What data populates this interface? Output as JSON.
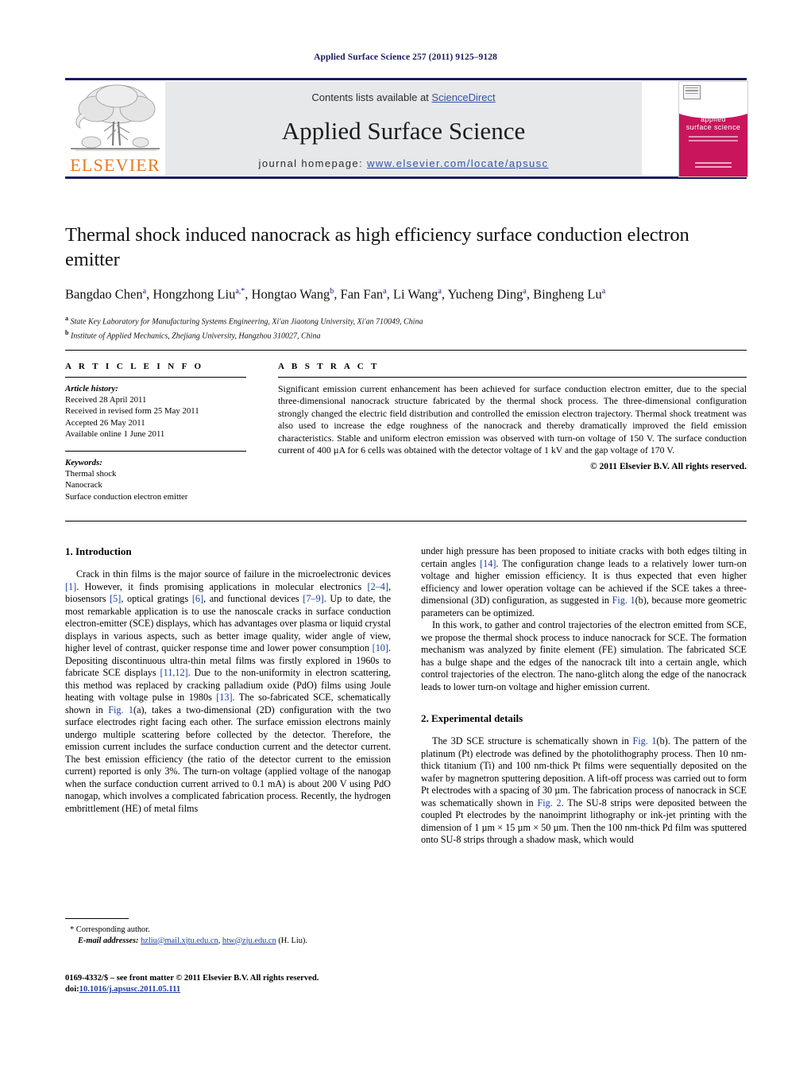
{
  "running_head": "Applied Surface Science 257 (2011) 9125–9128",
  "masthead": {
    "contents_prefix": "Contents lists available at ",
    "sciencedirect": "ScienceDirect",
    "journal_title": "Applied Surface Science",
    "homepage_prefix": "journal homepage: ",
    "homepage_url": "www.elsevier.com/locate/apsusc",
    "publisher_wordmark": "ELSEVIER",
    "publisher_logo_icon": "elsevier-tree-icon",
    "cover_title_line1": "applied",
    "cover_title_line2": "surface science",
    "cover_color": "#c9155b",
    "wordmark_color": "#E87722",
    "link_color": "#2f53a7"
  },
  "article": {
    "title": "Thermal shock induced nanocrack as high efficiency surface conduction electron emitter",
    "authors_html": "Bangdao Chen<sup>a</sup>, Hongzhong Liu<sup>a,*</sup>, Hongtao Wang<sup>b</sup>, Fan Fan<sup>a</sup>, Li Wang<sup>a</sup>, Yucheng Ding<sup>a</sup>, Bingheng Lu<sup>a</sup>",
    "affiliation_a": "State Key Laboratory for Manufacturing Systems Engineering, Xi'an Jiaotong University, Xi'an 710049, China",
    "affiliation_b": "Institute of Applied Mechanics, Zhejiang University, Hangzhou 310027, China",
    "affiliation_a_mark": "a",
    "affiliation_b_mark": "b"
  },
  "info": {
    "heading": "A R T I C L E    I N F O",
    "history_label": "Article history:",
    "history": [
      "Received 28 April 2011",
      "Received in revised form 25 May 2011",
      "Accepted 26 May 2011",
      "Available online 1 June 2011"
    ],
    "keywords_label": "Keywords:",
    "keywords": [
      "Thermal shock",
      "Nanocrack",
      "Surface conduction electron emitter"
    ]
  },
  "abstract": {
    "heading": "A B S T R A C T",
    "text": "Significant emission current enhancement has been achieved for surface conduction electron emitter, due to the special three-dimensional nanocrack structure fabricated by the thermal shock process. The three-dimensional configuration strongly changed the electric field distribution and controlled the emission electron trajectory. Thermal shock treatment was also used to increase the edge roughness of the nanocrack and thereby dramatically improved the field emission characteristics. Stable and uniform electron emission was observed with turn-on voltage of 150 V. The surface conduction current of 400 µA for 6 cells was obtained with the detector voltage of 1 kV and the gap voltage of 170 V.",
    "copyright": "© 2011 Elsevier B.V. All rights reserved."
  },
  "sections": {
    "intro_heading": "1.  Introduction",
    "intro_p1_a": "Crack in thin films is the major source of failure in the microelectronic devices ",
    "intro_p1_r1": "[1]",
    "intro_p1_b": ". However, it finds promising applications in molecular electronics ",
    "intro_p1_r2": "[2–4]",
    "intro_p1_c": ", biosensors ",
    "intro_p1_r3": "[5]",
    "intro_p1_d": ", optical gratings ",
    "intro_p1_r4": "[6]",
    "intro_p1_e": ", and functional devices ",
    "intro_p1_r5": "[7–9]",
    "intro_p1_f": ". Up to date, the most remarkable application is to use the nanoscale cracks in surface conduction electron-emitter (SCE) displays, which has advantages over plasma or liquid crystal displays in various aspects, such as better image quality, wider angle of view, higher level of contrast, quicker response time and lower power consumption ",
    "intro_p1_r6": "[10]",
    "intro_p1_g": ". Depositing discontinuous ultra-thin metal films was firstly explored in 1960s to fabricate SCE displays ",
    "intro_p1_r7": "[11,12]",
    "intro_p1_h": ". Due to the non-uniformity in electron scattering, this method was replaced by cracking palladium oxide (PdO) films using Joule heating with voltage pulse in 1980s ",
    "intro_p1_r8": "[13]",
    "intro_p1_i": ". The so-fabricated SCE, schematically shown in ",
    "intro_p1_f1": "Fig. 1",
    "intro_p1_j": "(a), takes a two-dimensional (2D) configuration with the two surface electrodes right facing each other. The surface emission electrons mainly undergo multiple scattering before collected by the detector. Therefore, the emission current includes the surface conduction current and the detector current. The best emission efficiency (the ratio of the detector current to the emission current) reported is only 3%. The turn-on voltage (applied voltage of the nanogap when the surface conduction current arrived to 0.1 mA) is about 200 V using PdO nanogap, which involves a complicated fabrication process. Recently, the hydrogen embrittlement (HE) of metal films",
    "intro_p2_a": "under high pressure has been proposed to initiate cracks with both edges tilting in certain angles ",
    "intro_p2_r1": "[14]",
    "intro_p2_b": ". The configuration change leads to a relatively lower turn-on voltage and higher emission efficiency. It is thus expected that even higher efficiency and lower operation voltage can be achieved if the SCE takes a three-dimensional (3D) configuration, as suggested in ",
    "intro_p2_f1": "Fig. 1",
    "intro_p2_c": "(b), because more geometric parameters can be optimized.",
    "intro_p3": "In this work, to gather and control trajectories of the electron emitted from SCE, we propose the thermal shock process to induce nanocrack for SCE. The formation mechanism was analyzed by finite element (FE) simulation. The fabricated SCE has a bulge shape and the edges of the nanocrack tilt into a certain angle, which control trajectories of the electron. The nano-glitch along the edge of the nanocrack leads to lower turn-on voltage and higher emission current.",
    "exp_heading": "2.  Experimental details",
    "exp_p1_a": "The 3D SCE structure is schematically shown in ",
    "exp_p1_f1": "Fig. 1",
    "exp_p1_b": "(b). The pattern of the platinum (Pt) electrode was defined by the photolithography process. Then 10 nm-thick titanium (Ti) and 100 nm-thick Pt films were sequentially deposited on the wafer by magnetron sputtering deposition. A lift-off process was carried out to form Pt electrodes with a spacing of 30 µm. The fabrication process of nanocrack in SCE was schematically shown in ",
    "exp_p1_f2": "Fig. 2",
    "exp_p1_c": ". The SU-8 strips were deposited between the coupled Pt electrodes by the nanoimprint lithography or ink-jet printing with the dimension of 1 µm × 15 µm × 50 µm. Then the 100 nm-thick Pd film was sputtered onto SU-8 strips through a shadow mask, which would"
  },
  "footnotes": {
    "corresponding": "* Corresponding author.",
    "email_label": "E-mail addresses:",
    "email_1": "hzliu@mail.xjtu.edu.cn",
    "email_sep": ", ",
    "email_2": "htw@zju.edu.cn",
    "email_suffix": " (H. Liu).",
    "imprint": "0169-4332/$ – see front matter © 2011 Elsevier B.V. All rights reserved.",
    "doi_label": "doi:",
    "doi_value": "10.1016/j.apsusc.2011.05.111"
  }
}
